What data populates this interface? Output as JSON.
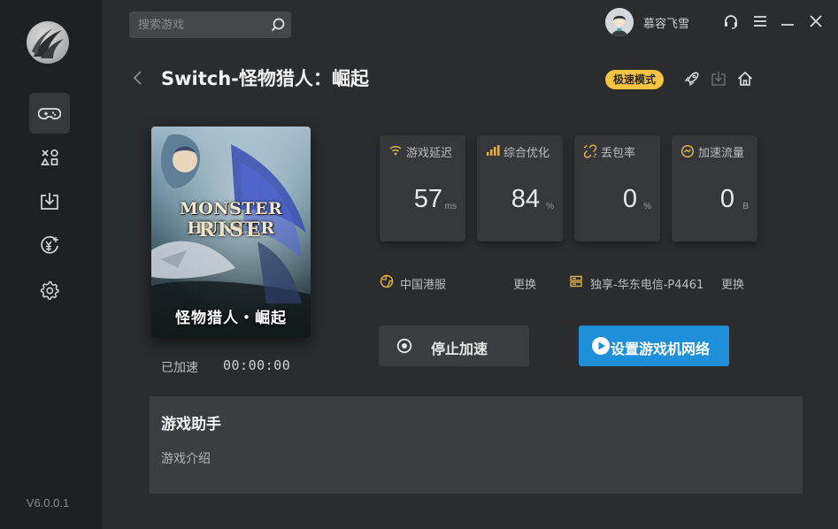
{
  "app": {
    "version": "V6.0.0.1"
  },
  "search": {
    "placeholder": "搜索游戏"
  },
  "user": {
    "name": "慕容飞雪"
  },
  "sidebar": {
    "items": [
      {
        "id": "games",
        "icon": "gamepad-icon",
        "active": true
      },
      {
        "id": "apps",
        "icon": "apps-grid-icon",
        "active": false
      },
      {
        "id": "downloads",
        "icon": "download-icon",
        "active": false
      },
      {
        "id": "recharge",
        "icon": "yuan-plus-icon",
        "active": false
      },
      {
        "id": "settings",
        "icon": "gear-icon",
        "active": false
      }
    ]
  },
  "header": {
    "title": "Switch-怪物猎人：崛起",
    "mode_badge": "极速模式"
  },
  "game": {
    "cover_title_en_1": "MONSTER HUNTER",
    "cover_title_en_2": "RISE",
    "cover_title_cn": "怪物猎人・崛起",
    "accel_label": "已加速",
    "accel_time": "00:00:00"
  },
  "stats": [
    {
      "label": "游戏延迟",
      "value": "57",
      "unit": "ms",
      "icon": "wifi-icon"
    },
    {
      "label": "综合优化",
      "value": "84",
      "unit": "%",
      "icon": "signal-bars-icon"
    },
    {
      "label": "丢包率",
      "value": "0",
      "unit": "%",
      "icon": "broken-link-icon"
    },
    {
      "label": "加速流量",
      "value": "0",
      "unit": "B",
      "icon": "traffic-icon"
    }
  ],
  "server": {
    "region": "中国港服",
    "region_change": "更换",
    "node": "独享-华东电信-P4461",
    "node_change": "更换"
  },
  "actions": {
    "stop_label": "停止加速",
    "setup_network_label": "设置游戏机网络"
  },
  "assistant": {
    "title": "游戏助手",
    "intro_link": "游戏介绍"
  },
  "colors": {
    "accent_blue": "#1f8fd9",
    "badge_yellow": "#f6c343",
    "icon_gold": "#e0b24a"
  }
}
